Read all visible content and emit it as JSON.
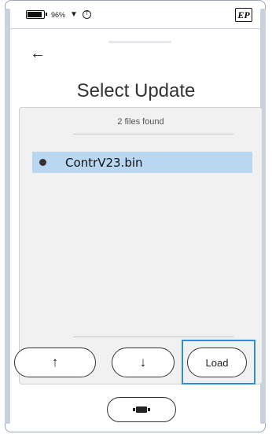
{
  "status_bar": {
    "battery_percent": "96%",
    "wifi_icon": "wifi-icon",
    "status_icon": "circle-t-icon",
    "logo_text": "EP"
  },
  "header": {
    "back_glyph": "←",
    "title": "Select Update"
  },
  "file_list": {
    "count_text": "2 files found",
    "items": [
      {
        "name": "ContrV23.bin",
        "selected": true
      }
    ]
  },
  "controls": {
    "up_label": "↑",
    "down_label": "↓",
    "load_label": "Load",
    "focused": "load"
  },
  "colors": {
    "selection": "#b9d7f1",
    "focus_outline": "#2f8fd1"
  }
}
